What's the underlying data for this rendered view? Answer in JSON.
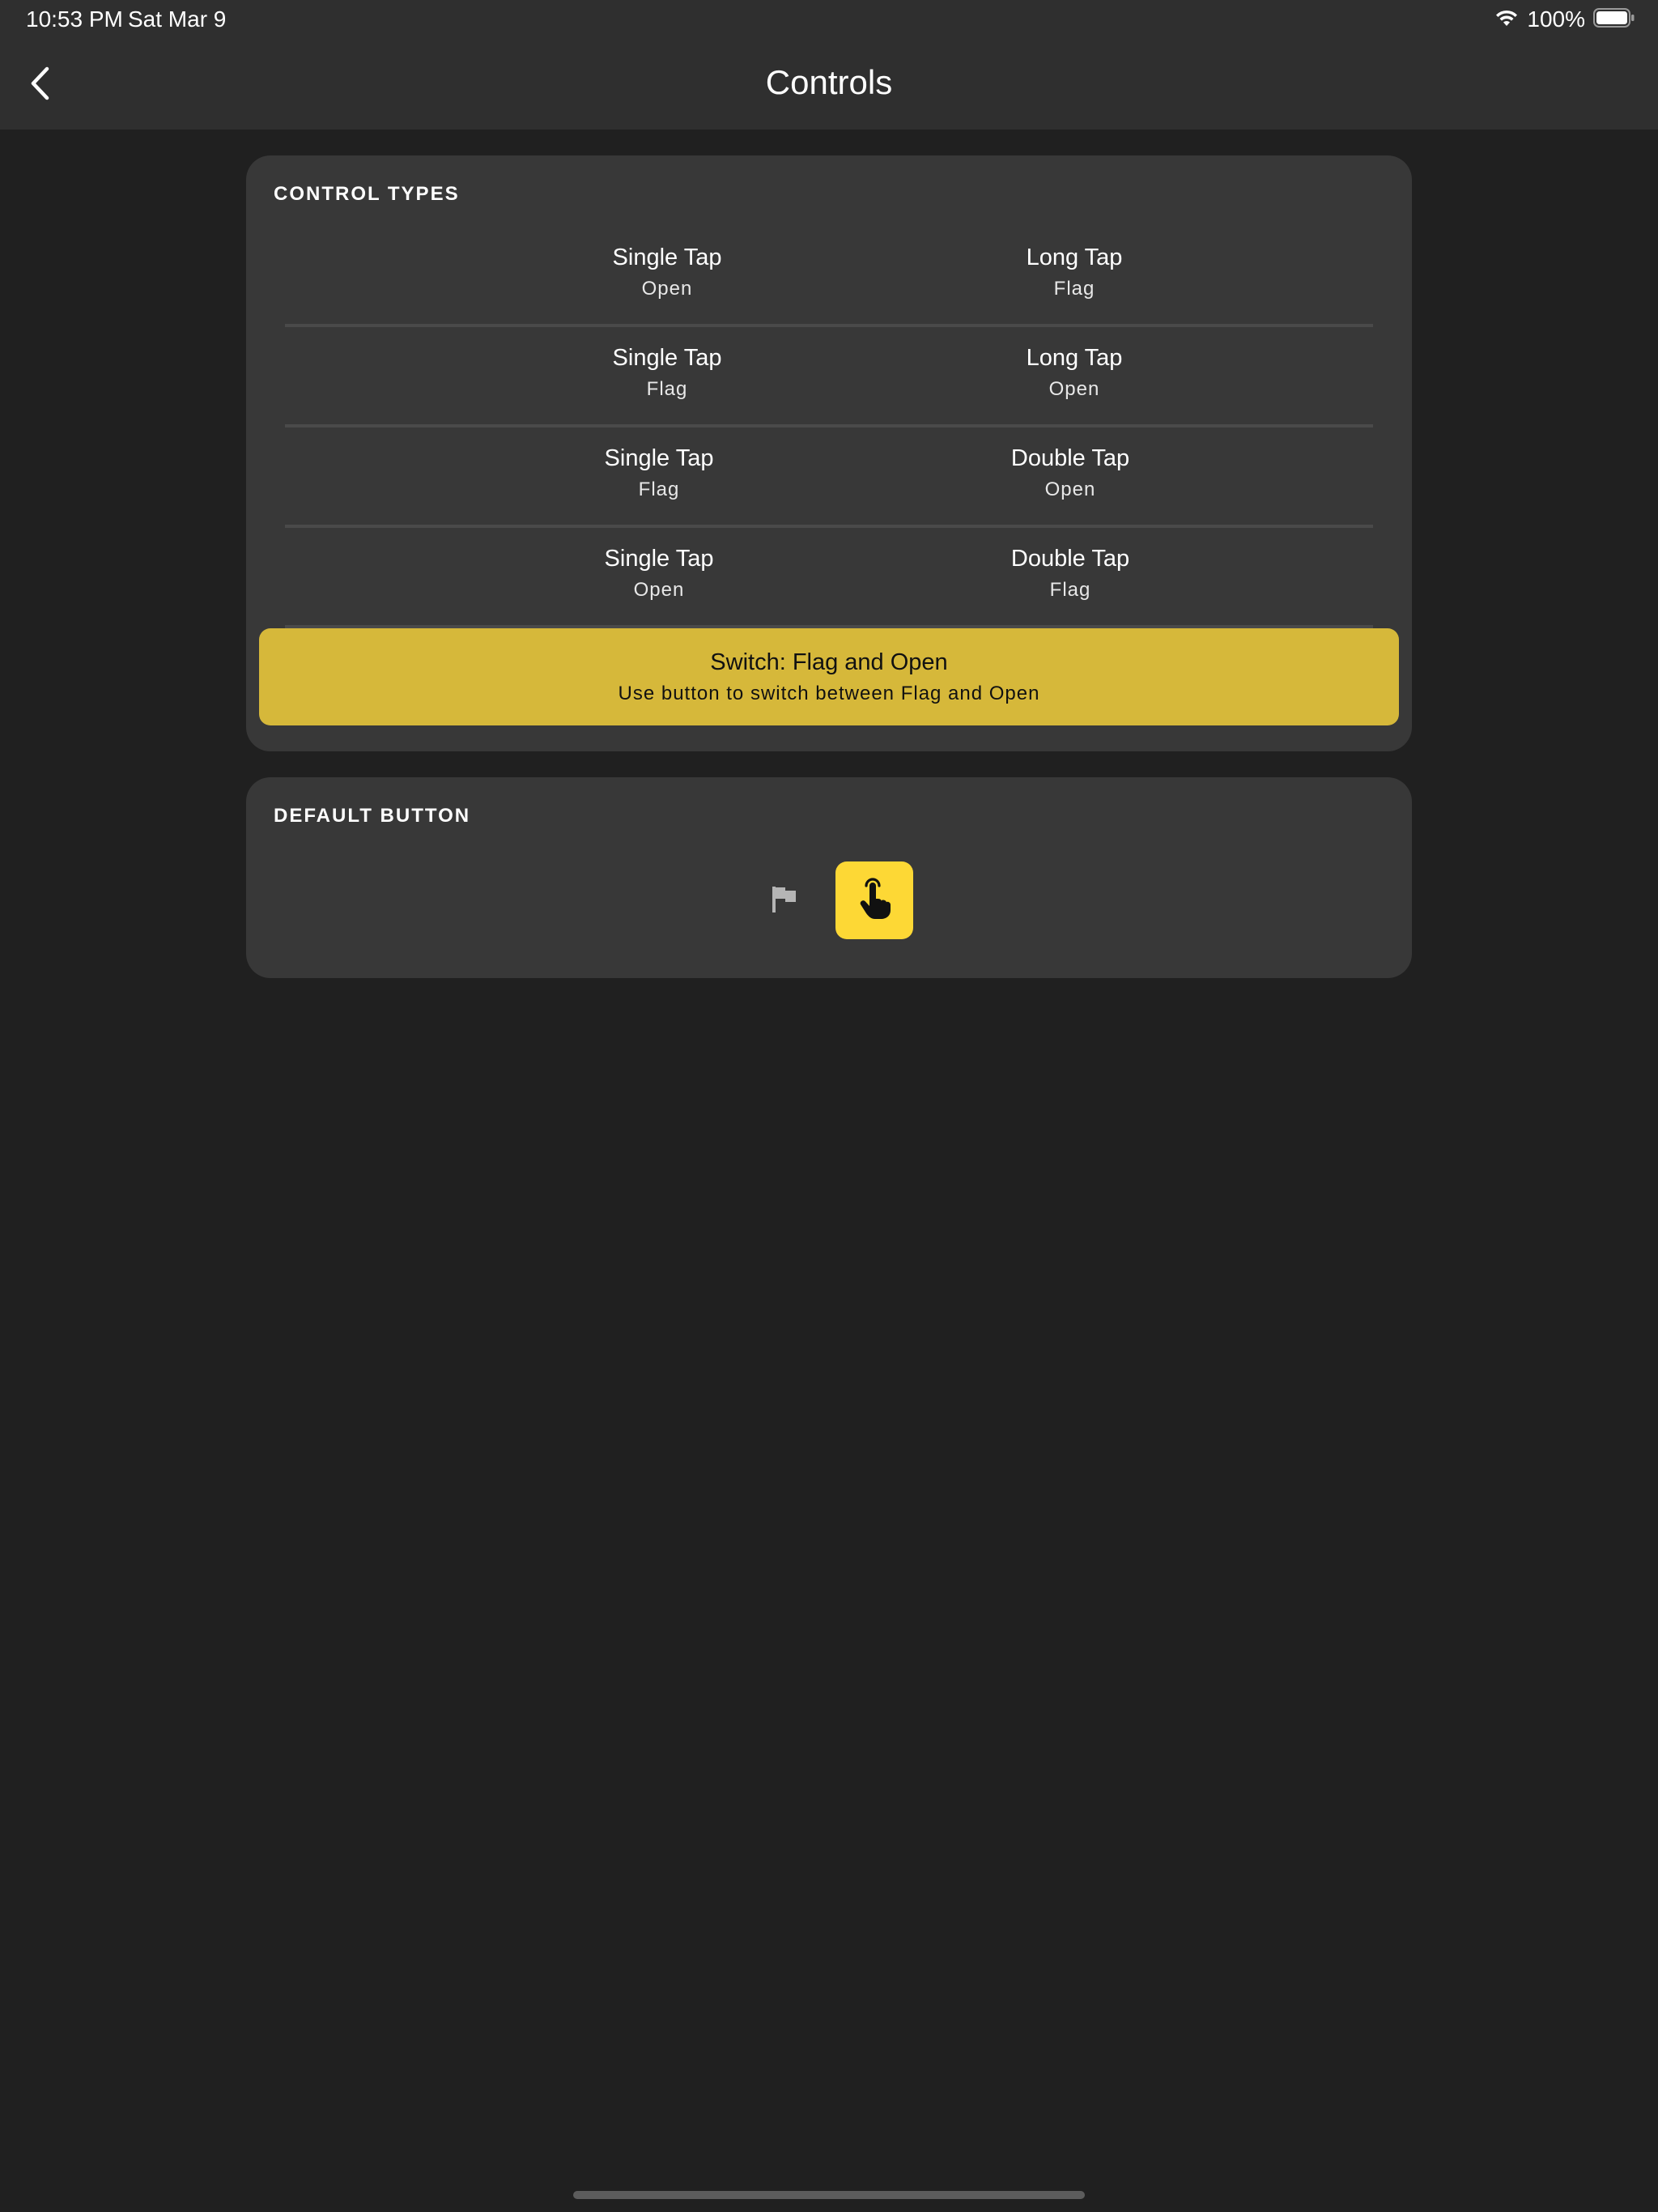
{
  "status_bar": {
    "time": "10:53 PM",
    "date": "Sat Mar 9",
    "battery_percent": "100%",
    "icons": [
      "wifi-icon",
      "battery-icon"
    ]
  },
  "nav": {
    "title": "Controls",
    "back_icon": "chevron-left-icon"
  },
  "control_types": {
    "header": "CONTROL TYPES",
    "rows": [
      {
        "left": {
          "label": "Single Tap",
          "sub": "Open"
        },
        "right": {
          "label": "Long Tap",
          "sub": "Flag"
        }
      },
      {
        "left": {
          "label": "Single Tap",
          "sub": "Flag"
        },
        "right": {
          "label": "Long Tap",
          "sub": "Open"
        }
      },
      {
        "left": {
          "label": "Single Tap",
          "sub": "Flag"
        },
        "right": {
          "label": "Double Tap",
          "sub": "Open"
        }
      },
      {
        "left": {
          "label": "Single Tap",
          "sub": "Open"
        },
        "right": {
          "label": "Double Tap",
          "sub": "Flag"
        }
      }
    ],
    "selected": {
      "label": "Switch: Flag and Open",
      "sub": "Use button to switch between Flag and Open"
    }
  },
  "default_button": {
    "header": "DEFAULT BUTTON",
    "options": [
      {
        "icon": "flag-icon",
        "selected": false
      },
      {
        "icon": "tap-icon",
        "selected": true
      }
    ]
  },
  "colors": {
    "background": "#202020",
    "card": "#383838",
    "selected_row": "#d6b83a",
    "accent_yellow": "#fdd835"
  }
}
